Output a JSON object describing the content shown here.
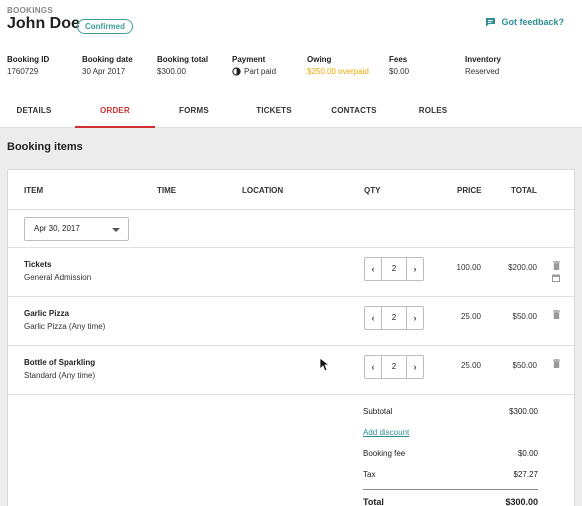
{
  "header": {
    "breadcrumb": "BOOKINGS",
    "title": "John Doe",
    "status_badge": "Confirmed",
    "feedback_label": "Got feedback?",
    "feedback_icon": "chat-bubble-icon",
    "accent_color": "#2f8e93"
  },
  "meta": [
    {
      "label": "Booking ID",
      "value": "1760729"
    },
    {
      "label": "Booking date",
      "value": "30 Apr 2017"
    },
    {
      "label": "Booking total",
      "value": "$300.00"
    },
    {
      "label": "Payment",
      "value": "Part paid",
      "icon": "half-circle-icon"
    },
    {
      "label": "Owing",
      "value": "$250.00 overpaid",
      "color": "#f2a900"
    },
    {
      "label": "Fees",
      "value": "$0.00"
    },
    {
      "label": "Inventory",
      "value": "Reserved"
    }
  ],
  "tabs": [
    {
      "label": "DETAILS"
    },
    {
      "label": "ORDER",
      "active": true
    },
    {
      "label": "FORMS"
    },
    {
      "label": "TICKETS"
    },
    {
      "label": "CONTACTS"
    },
    {
      "label": "ROLES"
    }
  ],
  "active_tab_color": "#d32f2f",
  "section_title": "Booking items",
  "table": {
    "columns": [
      "ITEM",
      "TIME",
      "LOCATION",
      "QTY",
      "PRICE",
      "TOTAL"
    ],
    "date_filter": "Apr 30, 2017",
    "rows": [
      {
        "name": "Tickets",
        "sub": "General Admission",
        "qty": "2",
        "price": "100.00",
        "total": "$200.00",
        "icons": [
          "trash-icon",
          "calendar-icon"
        ]
      },
      {
        "name": "Garlic Pizza",
        "sub": "Garlic Pizza (Any time)",
        "qty": "2",
        "price": "25.00",
        "total": "$50.00",
        "icons": [
          "trash-icon"
        ]
      },
      {
        "name": "Bottle of Sparkling",
        "sub": "Standard (Any time)",
        "qty": "2",
        "price": "25.00",
        "total": "$50.00",
        "icons": [
          "trash-icon"
        ]
      }
    ],
    "stepper_dec": "‹",
    "stepper_inc": "›"
  },
  "summary": {
    "subtotal_label": "Subtotal",
    "subtotal_value": "$300.00",
    "add_discount": "Add discount",
    "booking_fee_label": "Booking fee",
    "booking_fee_value": "$0.00",
    "tax_label": "Tax",
    "tax_value": "$27.27",
    "total_label": "Total",
    "total_value": "$300.00"
  }
}
